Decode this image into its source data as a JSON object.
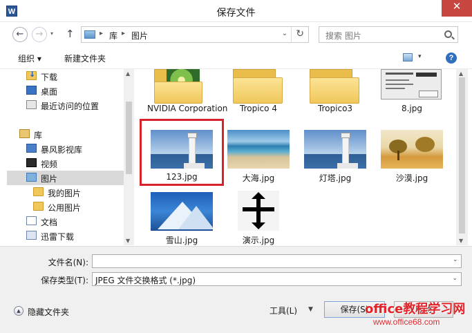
{
  "window": {
    "title": "保存文件",
    "app_icon": "W",
    "close_glyph": "✕"
  },
  "nav": {
    "back_glyph": "←",
    "forward_glyph": "→",
    "up_glyph": "↑",
    "history_glyph": "▾"
  },
  "address": {
    "crumbs": [
      "库",
      "图片"
    ],
    "separator": "▸",
    "dropdown_glyph": "⌄",
    "refresh_glyph": "↻"
  },
  "search": {
    "placeholder": "搜索 图片"
  },
  "toolbar": {
    "organize": "组织 ▾",
    "new_folder": "新建文件夹",
    "view_dd": "▾",
    "help": "?"
  },
  "sidebar": {
    "items": [
      {
        "label": "下载",
        "icon": "download-folder-icon"
      },
      {
        "label": "桌面",
        "icon": "desktop-icon"
      },
      {
        "label": "最近访问的位置",
        "icon": "recent-places-icon"
      },
      {
        "label": "库",
        "icon": "library-icon"
      },
      {
        "label": "暴风影视库",
        "icon": "media-library-icon"
      },
      {
        "label": "视频",
        "icon": "video-library-icon"
      },
      {
        "label": "图片",
        "icon": "pictures-library-icon",
        "selected": true
      },
      {
        "label": "我的图片",
        "icon": "folder-icon"
      },
      {
        "label": "公用图片",
        "icon": "folder-icon"
      },
      {
        "label": "文档",
        "icon": "documents-library-icon"
      },
      {
        "label": "迅雷下载",
        "icon": "xunlei-download-icon"
      }
    ]
  },
  "files": [
    {
      "name": "NVIDIA Corporation",
      "type": "folder"
    },
    {
      "name": "Tropico 4",
      "type": "folder"
    },
    {
      "name": "Tropico3",
      "type": "folder"
    },
    {
      "name": "8.jpg",
      "type": "image"
    },
    {
      "name": "123.jpg",
      "type": "image",
      "highlighted": true
    },
    {
      "name": "大海.jpg",
      "type": "image"
    },
    {
      "name": "灯塔.jpg",
      "type": "image"
    },
    {
      "name": "沙漠.jpg",
      "type": "image"
    },
    {
      "name": "雪山.jpg",
      "type": "image"
    },
    {
      "name": "演示.jpg",
      "type": "image"
    }
  ],
  "form": {
    "filename_label": "文件名(N):",
    "filename_value": "",
    "filetype_label": "保存类型(T):",
    "filetype_value": "JPEG 文件交换格式 (*.jpg)"
  },
  "footer": {
    "hide_folders": "隐藏文件夹",
    "tools": "工具(L)",
    "save": "保存(S)",
    "cancel": "取消"
  },
  "watermark": {
    "main": "office教程学习网",
    "url": "www.office68.com"
  },
  "colors": {
    "close_red": "#c7463f",
    "highlight_red": "#d8222a",
    "folder_yellow": "#f0c75a",
    "selection_gray": "#d9d9d9"
  }
}
